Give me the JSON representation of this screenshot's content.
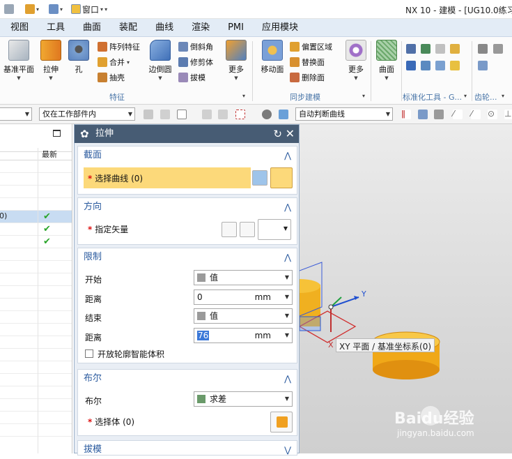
{
  "window": {
    "title": "NX 10 - 建模 - [UG10.0练习"
  },
  "quick_access": {
    "window_label": "窗口"
  },
  "menu_tabs": [
    "视图",
    "工具",
    "曲面",
    "装配",
    "曲线",
    "渲染",
    "PMI",
    "应用模块"
  ],
  "ribbon": {
    "datum_plane": "基准平面",
    "extrude": "拉伸",
    "hole": "孔",
    "pattern_feature": "阵列特征",
    "unite": "合并",
    "shell": "抽壳",
    "edge_blend": "边倒圆",
    "chamfer": "倒斜角",
    "trim_body": "修剪体",
    "draft": "拔模",
    "more": "更多",
    "feature_group": "特征",
    "move_face": "移动面",
    "offset_region": "偏置区域",
    "replace_face": "替换面",
    "delete_face": "删除面",
    "sync_more": "更多",
    "sync_group": "同步建模",
    "surface": "曲面",
    "standard_tools_group": "标准化工具 - G...",
    "gear_group": "齿轮..."
  },
  "filter_bar": {
    "scope": "仅在工作部件内",
    "curve_rule": "自动判断曲线"
  },
  "navigator": {
    "column_latest": "最新",
    "selected_row_fragment": "0)"
  },
  "dialog": {
    "title": "拉伸",
    "section": {
      "header": "截面",
      "select_curve": "选择曲线 (0)"
    },
    "direction": {
      "header": "方向",
      "specify_vector": "指定矢量"
    },
    "limits": {
      "header": "限制",
      "start_label": "开始",
      "start_value": "值",
      "start_distance_label": "距离",
      "start_distance": "0",
      "start_unit": "mm",
      "end_label": "结束",
      "end_value": "值",
      "end_distance_label": "距离",
      "end_distance": "76",
      "end_unit": "mm",
      "open_profile": "开放轮廓智能体积"
    },
    "boolean": {
      "header": "布尔",
      "label": "布尔",
      "value": "求差",
      "select_body": "选择体 (0)"
    },
    "draft": {
      "header": "拔模"
    }
  },
  "viewport": {
    "tooltip": "XY 平面 / 基准坐标系(0)",
    "axis_x": "X",
    "axis_y": "Y",
    "watermark": "Baidu经验",
    "watermark_url": "jingyan.baidu.com"
  },
  "colors": {
    "dialog_title_bg": "#475c74",
    "selection_highlight": "#fcd97a",
    "menu_bar": "#e3ecf6",
    "cylinder": "#f0b020"
  }
}
